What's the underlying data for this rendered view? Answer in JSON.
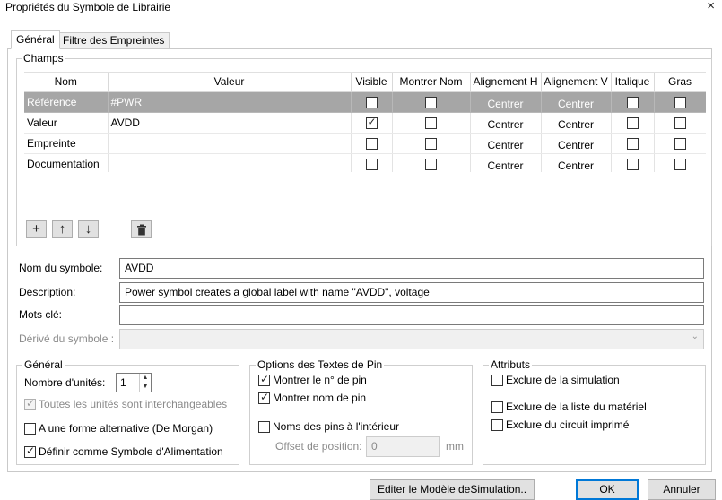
{
  "window": {
    "title": "Propriétés du Symbole de Librairie",
    "close_icon": "×"
  },
  "tabs": [
    {
      "label": "Général",
      "active": true
    },
    {
      "label": "Filtre des Empreintes",
      "active": false
    }
  ],
  "fields_group": {
    "legend": "Champs",
    "columns": [
      "Nom",
      "Valeur",
      "Visible",
      "Montrer Nom",
      "Alignement H",
      "Alignement V",
      "Italique",
      "Gras"
    ],
    "rows": [
      {
        "name": "Référence",
        "value": "#PWR",
        "visible": false,
        "show_name": false,
        "align_h": "Centrer",
        "align_v": "Centrer",
        "italic": false,
        "bold": false,
        "selected": true
      },
      {
        "name": "Valeur",
        "value": "AVDD",
        "visible": true,
        "show_name": false,
        "align_h": "Centrer",
        "align_v": "Centrer",
        "italic": false,
        "bold": false,
        "selected": false
      },
      {
        "name": "Empreinte",
        "value": "",
        "visible": false,
        "show_name": false,
        "align_h": "Centrer",
        "align_v": "Centrer",
        "italic": false,
        "bold": false,
        "selected": false
      },
      {
        "name": "Documentation",
        "value": "",
        "visible": false,
        "show_name": false,
        "align_h": "Centrer",
        "align_v": "Centrer",
        "italic": false,
        "bold": false,
        "selected": false
      }
    ],
    "toolbar": [
      {
        "name": "add-field-button",
        "icon": "plus-icon",
        "glyph": "+"
      },
      {
        "name": "move-up-button",
        "icon": "arrow-up-icon",
        "glyph": "↑"
      },
      {
        "name": "move-down-button",
        "icon": "arrow-down-icon",
        "glyph": "↓"
      },
      {
        "name": "delete-field-button",
        "icon": "trash-icon",
        "glyph": "🗑"
      }
    ]
  },
  "symbol": {
    "name_label": "Nom du symbole:",
    "name_value": "AVDD",
    "description_label": "Description:",
    "description_value": "Power symbol creates a global label with name \"AVDD\", voltage",
    "keywords_label": "Mots clé:",
    "keywords_value": "",
    "derived_label": "Dérivé du symbole :",
    "derived_value": ""
  },
  "general": {
    "legend": "Général",
    "units_label": "Nombre d'unités:",
    "units_value": "1",
    "interchangeable_label": "Toutes les unités sont interchangeables",
    "interchangeable_checked": true,
    "de_morgan_label": "A une forme alternative (De Morgan)",
    "de_morgan_checked": false,
    "power_symbol_label": "Définir comme Symbole d'Alimentation",
    "power_symbol_checked": true
  },
  "pin_text": {
    "legend": "Options des Textes de Pin",
    "show_pin_number_label": "Montrer le n° de pin",
    "show_pin_number_checked": true,
    "show_pin_name_label": "Montrer nom de pin",
    "show_pin_name_checked": true,
    "pin_names_inside_label": "Noms des pins à l'intérieur",
    "pin_names_inside_checked": false,
    "offset_label": "Offset de position:",
    "offset_value": "0",
    "offset_unit": "mm"
  },
  "attributes": {
    "legend": "Attributs",
    "exclude_sim_label": "Exclure de la simulation",
    "exclude_sim_checked": false,
    "exclude_bom_label": "Exclure de la liste du matériel",
    "exclude_bom_checked": false,
    "exclude_board_label": "Exclure du circuit imprimé",
    "exclude_board_checked": false
  },
  "footer": {
    "sim_model_button": "Editer le Modèle deSimulation..",
    "ok_button": "OK",
    "cancel_button": "Annuler"
  },
  "colors": {
    "selected_row": "#a6a6a6",
    "accent": "#0078d7"
  }
}
